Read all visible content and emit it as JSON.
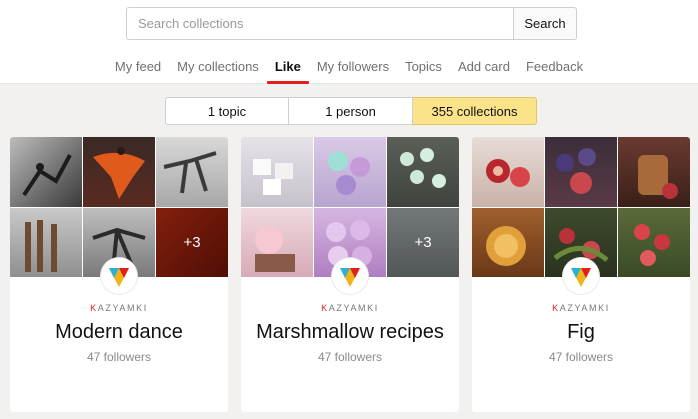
{
  "search": {
    "placeholder": "Search collections",
    "button_label": "Search"
  },
  "tabs": [
    {
      "label": "My feed",
      "active": false
    },
    {
      "label": "My collections",
      "active": false
    },
    {
      "label": "Like",
      "active": true
    },
    {
      "label": "My followers",
      "active": false
    },
    {
      "label": "Topics",
      "active": false
    },
    {
      "label": "Add card",
      "active": false
    },
    {
      "label": "Feedback",
      "active": false
    }
  ],
  "filters": [
    {
      "label": "1 topic",
      "selected": false
    },
    {
      "label": "1 person",
      "selected": false
    },
    {
      "label": "355 collections",
      "selected": true
    }
  ],
  "cards": [
    {
      "author_first": "K",
      "author_rest": "AZYAMKI",
      "title": "Modern dance",
      "followers": "47 followers",
      "more": "+3"
    },
    {
      "author_first": "K",
      "author_rest": "AZYAMKI",
      "title": "Marshmallow recipes",
      "followers": "47 followers",
      "more": "+3"
    },
    {
      "author_first": "K",
      "author_rest": "AZYAMKI",
      "title": "Fig",
      "followers": "47 followers",
      "more": ""
    }
  ],
  "colors": {
    "accent": "#e0201b",
    "selected_filter": "#fbe38a",
    "page_bg": "#f2f1ef"
  }
}
